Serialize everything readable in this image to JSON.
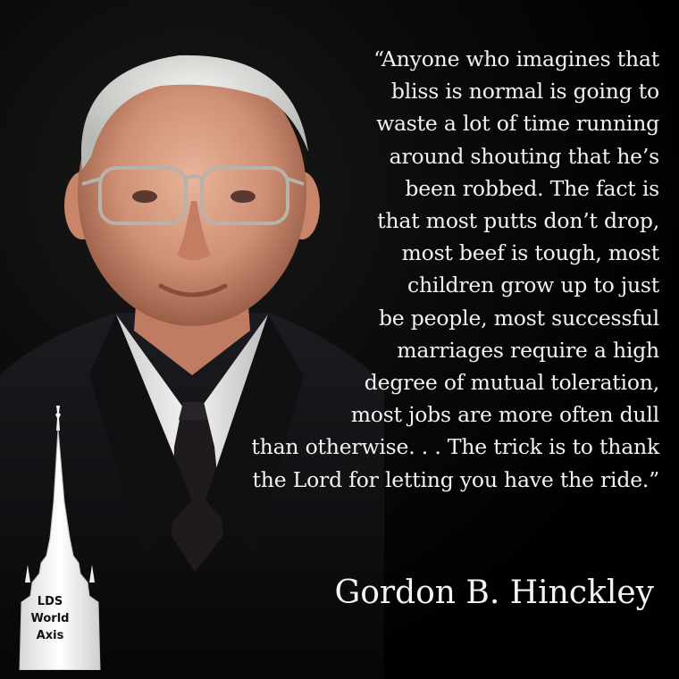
{
  "quote": {
    "lines": [
      "“Anyone who imagines that",
      "bliss is normal is going to",
      "waste a lot of time running",
      "around shouting that he’s",
      "been robbed. The fact is",
      "that most putts don’t drop,",
      "most beef is tough, most",
      "children grow up to just",
      "be people, most successful",
      "marriages require a high",
      "degree of mutual toleration,",
      "most jobs are more often dull",
      "than otherwise. . . The trick is to thank",
      "the Lord for letting you have the ride.”"
    ]
  },
  "author": "Gordon B. Hinckley",
  "logo": {
    "line1": "LDS",
    "line2": "World",
    "line3": "Axis"
  },
  "colors": {
    "background": "#000000",
    "text": "#f2f2f2",
    "suit": "#141416",
    "shirt": "#e6e6e6"
  }
}
